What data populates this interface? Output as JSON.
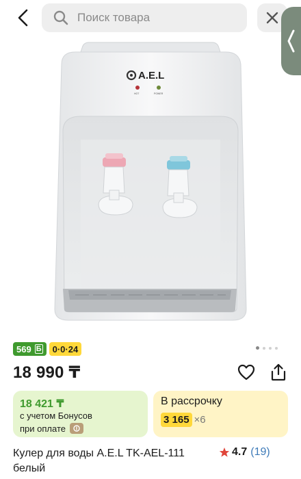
{
  "search": {
    "placeholder": "Поиск товара"
  },
  "product": {
    "brand_label": "A.E.L",
    "indicator_labels": [
      "HOT",
      "POWER"
    ],
    "badges": {
      "bonus": "569",
      "bonus_symbol": "Б",
      "installment": "0·0·24"
    },
    "price": "18 990 ₸",
    "bonus_card": {
      "price": "18 421 ₸",
      "line1": "с учетом Бонусов",
      "line2": "при оплате"
    },
    "installment_card": {
      "title": "В рассрочку",
      "amount": "3 165",
      "multiplier": "×6"
    },
    "title": "Кулер для воды A.E.L TK-AEL-111 белый",
    "rating": {
      "value": "4.7",
      "count": "(19)"
    }
  },
  "colors": {
    "green": "#3f9a2e",
    "yellow": "#ffd83a",
    "link": "#3d7ab8",
    "star": "#e0453a"
  },
  "gallery": {
    "pages": 4,
    "active_index": 0
  }
}
